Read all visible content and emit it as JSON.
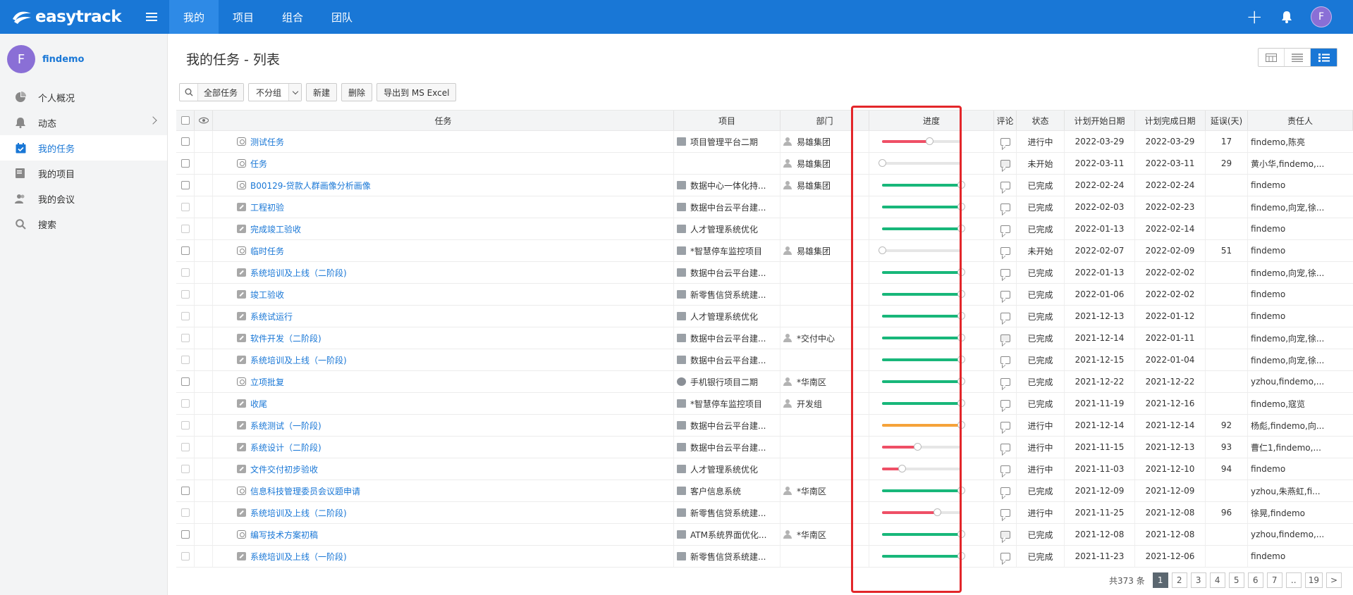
{
  "app": {
    "brand": "easytrack",
    "nav": [
      {
        "label": "我的",
        "active": true
      },
      {
        "label": "项目"
      },
      {
        "label": "组合"
      },
      {
        "label": "团队"
      }
    ],
    "avatar_letter": "F"
  },
  "sidebar": {
    "user": {
      "avatar": "F",
      "name": "findemo"
    },
    "items": [
      {
        "label": "个人概况",
        "icon": "pie-chart-icon"
      },
      {
        "label": "动态",
        "icon": "bell-icon",
        "has_chevron": true
      },
      {
        "label": "我的任务",
        "icon": "calendar-check-icon",
        "active": true
      },
      {
        "label": "我的项目",
        "icon": "folder-icon"
      },
      {
        "label": "我的会议",
        "icon": "people-icon"
      },
      {
        "label": "搜索",
        "icon": "search-icon"
      }
    ]
  },
  "page": {
    "title": "我的任务 - 列表"
  },
  "toolbar": {
    "filter": "全部任务",
    "group": "不分组",
    "new": "新建",
    "delete": "删除",
    "export": "导出到 MS Excel"
  },
  "table": {
    "headers": {
      "task": "任务",
      "project": "项目",
      "dept": "部门",
      "progress": "进度",
      "comment": "评论",
      "status": "状态",
      "start": "计划开始日期",
      "end": "计划完成日期",
      "delay": "延误(天)",
      "owner": "责任人"
    },
    "rows": [
      {
        "type": "clock",
        "task": "测试任务",
        "project": "项目管理平台二期",
        "dept": "易雄集团",
        "progress": 0.6,
        "color": "#ef4f66",
        "comment": false,
        "status": "进行中",
        "start": "2022-03-29",
        "end": "2022-03-29",
        "delay": "17",
        "owner": "findemo,陈亮"
      },
      {
        "type": "clock",
        "task": "任务",
        "project": "",
        "dept": "易雄集团",
        "progress": 0.0,
        "color": "#ef4f66",
        "comment": true,
        "status": "未开始",
        "start": "2022-03-11",
        "end": "2022-03-11",
        "delay": "29",
        "owner": "黄小华,findemo,..."
      },
      {
        "type": "clock",
        "task": "B00129-贷款人群画像分析画像",
        "project": "数据中心一体化持...",
        "dept": "易雄集团",
        "progress": 1.0,
        "color": "#18b77a",
        "comment": false,
        "status": "已完成",
        "start": "2022-02-24",
        "end": "2022-02-24",
        "delay": "",
        "owner": "findemo"
      },
      {
        "type": "edit",
        "task": "工程初验",
        "project": "数据中台云平台建...",
        "dept": "",
        "progress": 1.0,
        "color": "#18b77a",
        "comment": false,
        "status": "已完成",
        "start": "2022-02-03",
        "end": "2022-02-23",
        "delay": "",
        "owner": "findemo,向宠,徐..."
      },
      {
        "type": "edit",
        "task": "完成竣工验收",
        "project": "人才管理系统优化",
        "dept": "",
        "progress": 1.0,
        "color": "#18b77a",
        "comment": false,
        "status": "已完成",
        "start": "2022-01-13",
        "end": "2022-02-14",
        "delay": "",
        "owner": "findemo"
      },
      {
        "type": "clock",
        "task": "临时任务",
        "project": "*智慧停车监控项目",
        "dept": "易雄集团",
        "progress": 0.0,
        "color": "#ef4f66",
        "comment": false,
        "status": "未开始",
        "start": "2022-02-07",
        "end": "2022-02-09",
        "delay": "51",
        "owner": "findemo"
      },
      {
        "type": "edit",
        "task": "系统培训及上线（二阶段)",
        "project": "数据中台云平台建...",
        "dept": "",
        "progress": 1.0,
        "color": "#18b77a",
        "comment": false,
        "status": "已完成",
        "start": "2022-01-13",
        "end": "2022-02-02",
        "delay": "",
        "owner": "findemo,向宠,徐..."
      },
      {
        "type": "edit",
        "task": "竣工验收",
        "project": "新零售信贷系统建...",
        "dept": "",
        "progress": 1.0,
        "color": "#18b77a",
        "comment": false,
        "status": "已完成",
        "start": "2022-01-06",
        "end": "2022-02-02",
        "delay": "",
        "owner": "findemo"
      },
      {
        "type": "edit",
        "task": "系统试运行",
        "project": "人才管理系统优化",
        "dept": "",
        "progress": 1.0,
        "color": "#18b77a",
        "comment": false,
        "status": "已完成",
        "start": "2021-12-13",
        "end": "2022-01-12",
        "delay": "",
        "owner": "findemo"
      },
      {
        "type": "edit",
        "task": "软件开发（二阶段)",
        "project": "数据中台云平台建...",
        "dept": "*交付中心",
        "progress": 1.0,
        "color": "#18b77a",
        "comment": true,
        "status": "已完成",
        "start": "2021-12-14",
        "end": "2022-01-11",
        "delay": "",
        "owner": "findemo,向宠,徐..."
      },
      {
        "type": "edit",
        "task": "系统培训及上线（一阶段)",
        "project": "数据中台云平台建...",
        "dept": "",
        "progress": 1.0,
        "color": "#18b77a",
        "comment": false,
        "status": "已完成",
        "start": "2021-12-15",
        "end": "2022-01-04",
        "delay": "",
        "owner": "findemo,向宠,徐..."
      },
      {
        "type": "clock",
        "task": "立项批复",
        "project": "手机银行项目二期",
        "dept": "*华南区",
        "progress": 1.0,
        "color": "#18b77a",
        "comment": false,
        "status": "已完成",
        "start": "2021-12-22",
        "end": "2021-12-22",
        "delay": "",
        "owner": "yzhou,findemo,..."
      },
      {
        "type": "edit",
        "task": "收尾",
        "project": "*智慧停车监控项目",
        "dept": "开发组",
        "progress": 1.0,
        "color": "#18b77a",
        "comment": false,
        "status": "已完成",
        "start": "2021-11-19",
        "end": "2021-12-16",
        "delay": "",
        "owner": "findemo,寇览"
      },
      {
        "type": "edit",
        "task": "系统测试（一阶段)",
        "project": "数据中台云平台建...",
        "dept": "",
        "progress": 1.0,
        "color": "#f5a33a",
        "comment": false,
        "status": "进行中",
        "start": "2021-12-14",
        "end": "2021-12-14",
        "delay": "92",
        "owner": "杨彪,findemo,向..."
      },
      {
        "type": "edit",
        "task": "系统设计（二阶段)",
        "project": "数据中台云平台建...",
        "dept": "",
        "progress": 0.45,
        "color": "#ef4f66",
        "comment": false,
        "status": "进行中",
        "start": "2021-11-15",
        "end": "2021-12-13",
        "delay": "93",
        "owner": "曹仁1,findemo,..."
      },
      {
        "type": "edit",
        "task": "文件交付初步验收",
        "project": "人才管理系统优化",
        "dept": "",
        "progress": 0.25,
        "color": "#ef4f66",
        "comment": false,
        "status": "进行中",
        "start": "2021-11-03",
        "end": "2021-12-10",
        "delay": "94",
        "owner": "findemo"
      },
      {
        "type": "clock",
        "task": "信息科技管理委员会议题申请",
        "project": "客户信息系统",
        "dept": "*华南区",
        "progress": 1.0,
        "color": "#18b77a",
        "comment": false,
        "status": "已完成",
        "start": "2021-12-09",
        "end": "2021-12-09",
        "delay": "",
        "owner": "yzhou,朱燕虹,fi..."
      },
      {
        "type": "edit",
        "task": "系统培训及上线（二阶段)",
        "project": "新零售信贷系统建...",
        "dept": "",
        "progress": 0.7,
        "color": "#ef4f66",
        "comment": false,
        "status": "进行中",
        "start": "2021-11-25",
        "end": "2021-12-08",
        "delay": "96",
        "owner": "徐晃,findemo"
      },
      {
        "type": "clock",
        "task": "编写技术方案初稿",
        "project": "ATM系统界面优化...",
        "dept": "*华南区",
        "progress": 1.0,
        "color": "#18b77a",
        "comment": true,
        "status": "已完成",
        "start": "2021-12-08",
        "end": "2021-12-08",
        "delay": "",
        "owner": "yzhou,findemo,..."
      },
      {
        "type": "edit",
        "task": "系统培训及上线（一阶段)",
        "project": "新零售信贷系统建...",
        "dept": "",
        "progress": 1.0,
        "color": "#18b77a",
        "comment": false,
        "status": "已完成",
        "start": "2021-11-23",
        "end": "2021-12-06",
        "delay": "",
        "owner": "findemo"
      }
    ]
  },
  "pager": {
    "total": "共373 条",
    "pages": [
      "1",
      "2",
      "3",
      "4",
      "5",
      "6",
      "7",
      "..",
      "19",
      ">"
    ],
    "current": "1"
  }
}
